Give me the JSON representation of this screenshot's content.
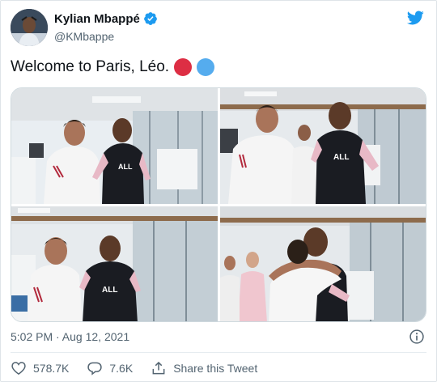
{
  "author": {
    "name": "Kylian Mbappé",
    "handle": "@KMbappe"
  },
  "tweet": {
    "text": "Welcome to Paris, Léo.",
    "emoji": [
      "red-circle",
      "blue-circle"
    ],
    "timestamp": "5:02 PM · Aug 12, 2021"
  },
  "media": {
    "photo_count": 4,
    "jersey_text": "ALL"
  },
  "actions": {
    "likes": "578.7K",
    "replies": "7.6K",
    "share_label": "Share this Tweet"
  },
  "colors": {
    "twitter_blue": "#1d9bf0",
    "red_circle": "#dd2e44",
    "blue_circle": "#55acee",
    "secondary_text": "#536471"
  }
}
